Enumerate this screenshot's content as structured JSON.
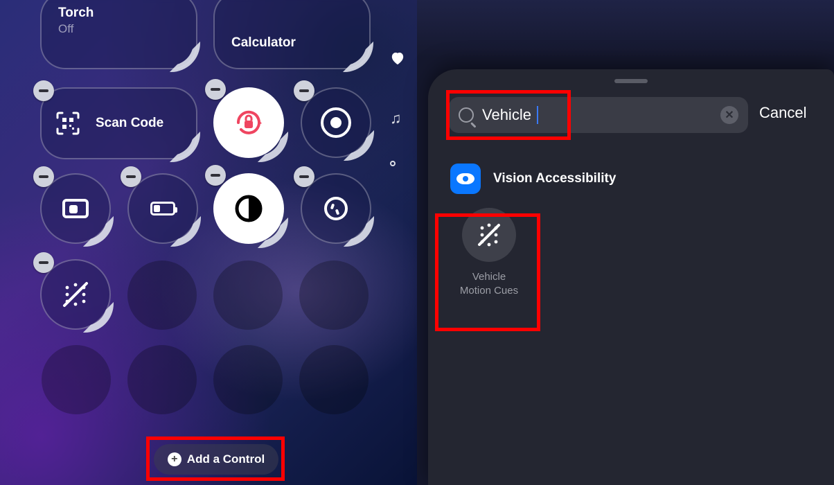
{
  "left": {
    "torch": {
      "title": "Torch",
      "status": "Off"
    },
    "calculator": {
      "title": "Calculator"
    },
    "scan": {
      "label": "Scan Code"
    },
    "addControl": "Add a Control",
    "icons": {
      "lock": "rotation-lock-icon",
      "record": "screen-record-icon",
      "camera": "camera-icon",
      "battery": "low-power-icon",
      "dark": "dark-mode-icon",
      "alarm": "alarm-icon",
      "motion": "motion-cues-icon",
      "heart": "heart-icon",
      "music": "music-icon"
    }
  },
  "right": {
    "search": {
      "value": "Vehicle",
      "placeholder": "Search"
    },
    "cancel": "Cancel",
    "sectionTitle": "Vision Accessibility",
    "result": {
      "title": "Vehicle\nMotion Cues"
    }
  }
}
